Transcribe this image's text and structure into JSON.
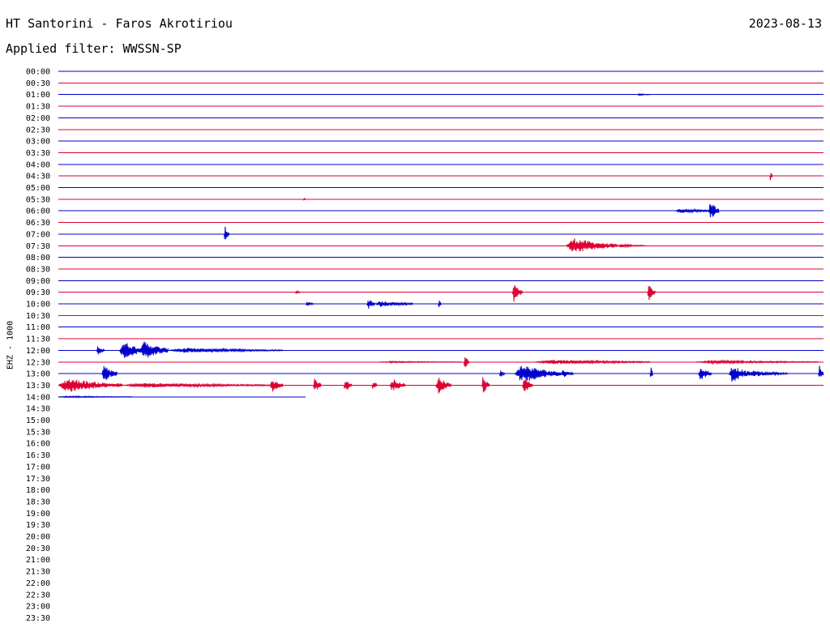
{
  "header": {
    "title": "HT Santorini - Faros Akrotiriou",
    "date": "2023-08-13",
    "filter": "Applied filter: WWSSN-SP"
  },
  "chart_data": {
    "type": "line",
    "title": "HT Santorini - Faros Akrotiriou",
    "ylabel": "EHZ - 1000",
    "trace_colors": [
      "#0000cc",
      "#dd0033"
    ],
    "rows": [
      "00:00",
      "00:30",
      "01:00",
      "01:30",
      "02:00",
      "02:30",
      "03:00",
      "03:30",
      "04:00",
      "04:30",
      "05:00",
      "05:30",
      "06:00",
      "06:30",
      "07:00",
      "07:30",
      "08:00",
      "08:30",
      "09:00",
      "09:30",
      "10:00",
      "10:30",
      "11:00",
      "11:30",
      "12:00",
      "12:30",
      "13:00",
      "13:30",
      "14:00",
      "14:30",
      "15:00",
      "15:30",
      "16:00",
      "16:30",
      "17:00",
      "17:30",
      "18:00",
      "18:30",
      "19:00",
      "19:30",
      "20:00",
      "20:30",
      "21:00",
      "21:30",
      "22:00",
      "22:30",
      "23:00",
      "23:30"
    ],
    "x_minutes": [
      0,
      30
    ],
    "trace_end_row": 28,
    "trace_end_minute": 9.7,
    "events": [
      {
        "row": 2,
        "minute": 22.7,
        "dur": 0.5,
        "amp": 1
      },
      {
        "row": 9,
        "minute": 27.9,
        "dur": 0.1,
        "amp": 6
      },
      {
        "row": 11,
        "minute": 9.6,
        "dur": 0.1,
        "amp": 2
      },
      {
        "row": 12,
        "minute": 24.2,
        "dur": 1.5,
        "amp": 3
      },
      {
        "row": 12,
        "minute": 25.5,
        "dur": 0.4,
        "amp": 13
      },
      {
        "row": 14,
        "minute": 6.5,
        "dur": 0.2,
        "amp": 11
      },
      {
        "row": 15,
        "minute": 19.9,
        "dur": 2.0,
        "amp": 10
      },
      {
        "row": 15,
        "minute": 21.9,
        "dur": 1.1,
        "amp": 2
      },
      {
        "row": 19,
        "minute": 9.3,
        "dur": 0.2,
        "amp": 2
      },
      {
        "row": 19,
        "minute": 17.8,
        "dur": 0.4,
        "amp": 12
      },
      {
        "row": 19,
        "minute": 23.1,
        "dur": 0.3,
        "amp": 11
      },
      {
        "row": 20,
        "minute": 9.7,
        "dur": 0.3,
        "amp": 3
      },
      {
        "row": 20,
        "minute": 12.1,
        "dur": 0.3,
        "amp": 8
      },
      {
        "row": 20,
        "minute": 12.4,
        "dur": 1.5,
        "amp": 4
      },
      {
        "row": 20,
        "minute": 14.9,
        "dur": 0.1,
        "amp": 7
      },
      {
        "row": 24,
        "minute": 1.5,
        "dur": 0.3,
        "amp": 7
      },
      {
        "row": 24,
        "minute": 2.4,
        "dur": 1.0,
        "amp": 12
      },
      {
        "row": 24,
        "minute": 3.2,
        "dur": 1.1,
        "amp": 12
      },
      {
        "row": 24,
        "minute": 4.3,
        "dur": 4.5,
        "amp": 3
      },
      {
        "row": 25,
        "minute": 12.6,
        "dur": 3.2,
        "amp": 1
      },
      {
        "row": 25,
        "minute": 15.9,
        "dur": 0.2,
        "amp": 11
      },
      {
        "row": 25,
        "minute": 18.7,
        "dur": 4.5,
        "amp": 3
      },
      {
        "row": 25,
        "minute": 25.0,
        "dur": 4.8,
        "amp": 2
      },
      {
        "row": 26,
        "minute": 1.7,
        "dur": 0.6,
        "amp": 11
      },
      {
        "row": 26,
        "minute": 17.3,
        "dur": 0.2,
        "amp": 5
      },
      {
        "row": 26,
        "minute": 17.9,
        "dur": 1.8,
        "amp": 12
      },
      {
        "row": 26,
        "minute": 19.7,
        "dur": 0.5,
        "amp": 5
      },
      {
        "row": 26,
        "minute": 23.2,
        "dur": 0.1,
        "amp": 12
      },
      {
        "row": 26,
        "minute": 25.1,
        "dur": 0.5,
        "amp": 10
      },
      {
        "row": 26,
        "minute": 26.3,
        "dur": 0.8,
        "amp": 12
      },
      {
        "row": 26,
        "minute": 27.0,
        "dur": 1.6,
        "amp": 4
      },
      {
        "row": 26,
        "minute": 29.8,
        "dur": 0.2,
        "amp": 12
      },
      {
        "row": 27,
        "minute": 0.0,
        "dur": 2.5,
        "amp": 9
      },
      {
        "row": 27,
        "minute": 2.5,
        "dur": 6.0,
        "amp": 3
      },
      {
        "row": 27,
        "minute": 8.3,
        "dur": 0.5,
        "amp": 9
      },
      {
        "row": 27,
        "minute": 10.0,
        "dur": 0.3,
        "amp": 10
      },
      {
        "row": 27,
        "minute": 11.2,
        "dur": 0.3,
        "amp": 10
      },
      {
        "row": 27,
        "minute": 12.3,
        "dur": 0.2,
        "amp": 8
      },
      {
        "row": 27,
        "minute": 13.0,
        "dur": 0.6,
        "amp": 9
      },
      {
        "row": 27,
        "minute": 14.8,
        "dur": 0.6,
        "amp": 11
      },
      {
        "row": 27,
        "minute": 16.6,
        "dur": 0.3,
        "amp": 12
      },
      {
        "row": 27,
        "minute": 18.2,
        "dur": 0.4,
        "amp": 11
      },
      {
        "row": 28,
        "minute": 0.0,
        "dur": 2.9,
        "amp": 1
      }
    ]
  }
}
